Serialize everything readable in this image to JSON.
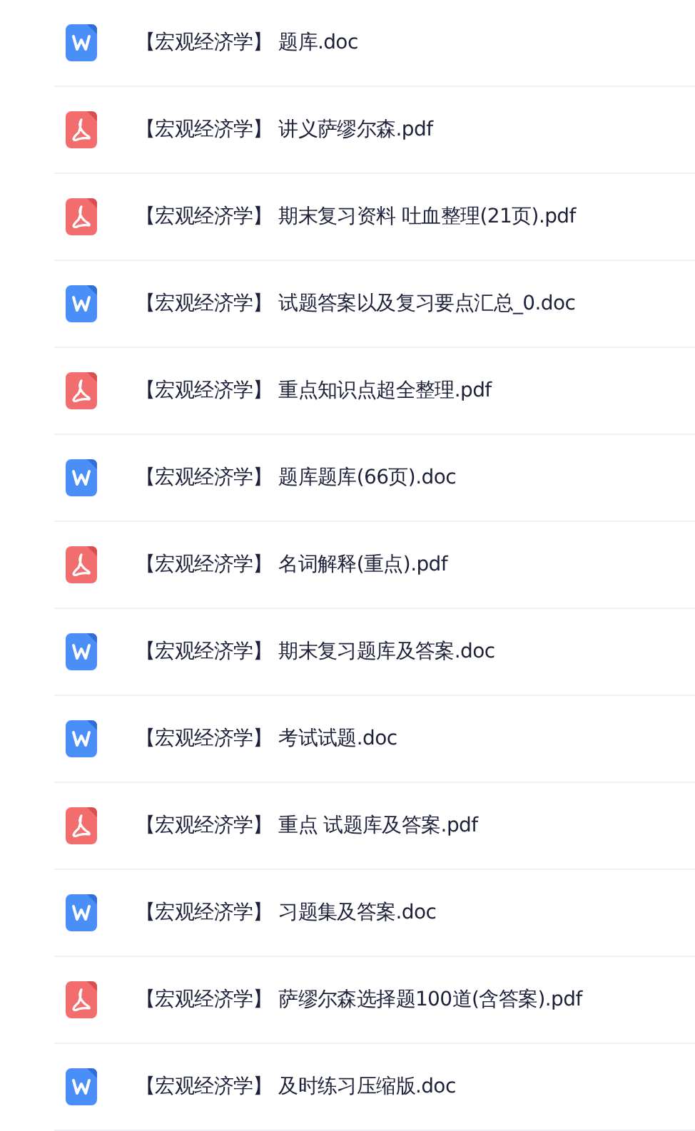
{
  "files": [
    {
      "kind": "doc",
      "title": "【宏观经济学】 题库.doc"
    },
    {
      "kind": "pdf",
      "title": "【宏观经济学】 讲义萨缪尔森.pdf"
    },
    {
      "kind": "pdf",
      "title": "【宏观经济学】 期末复习资料 吐血整理(21页).pdf"
    },
    {
      "kind": "doc",
      "title": "【宏观经济学】 试题答案以及复习要点汇总_0.doc"
    },
    {
      "kind": "pdf",
      "title": "【宏观经济学】 重点知识点超全整理.pdf"
    },
    {
      "kind": "doc",
      "title": "【宏观经济学】 题库题库(66页).doc"
    },
    {
      "kind": "pdf",
      "title": "【宏观经济学】 名词解释(重点).pdf"
    },
    {
      "kind": "doc",
      "title": "【宏观经济学】 期末复习题库及答案.doc"
    },
    {
      "kind": "doc",
      "title": "【宏观经济学】 考试试题.doc"
    },
    {
      "kind": "pdf",
      "title": "【宏观经济学】 重点 试题库及答案.pdf"
    },
    {
      "kind": "doc",
      "title": "【宏观经济学】 习题集及答案.doc"
    },
    {
      "kind": "pdf",
      "title": "【宏观经济学】 萨缪尔森选择题100道(含答案).pdf"
    },
    {
      "kind": "doc",
      "title": "【宏观经济学】 及时练习压缩版.doc"
    }
  ]
}
